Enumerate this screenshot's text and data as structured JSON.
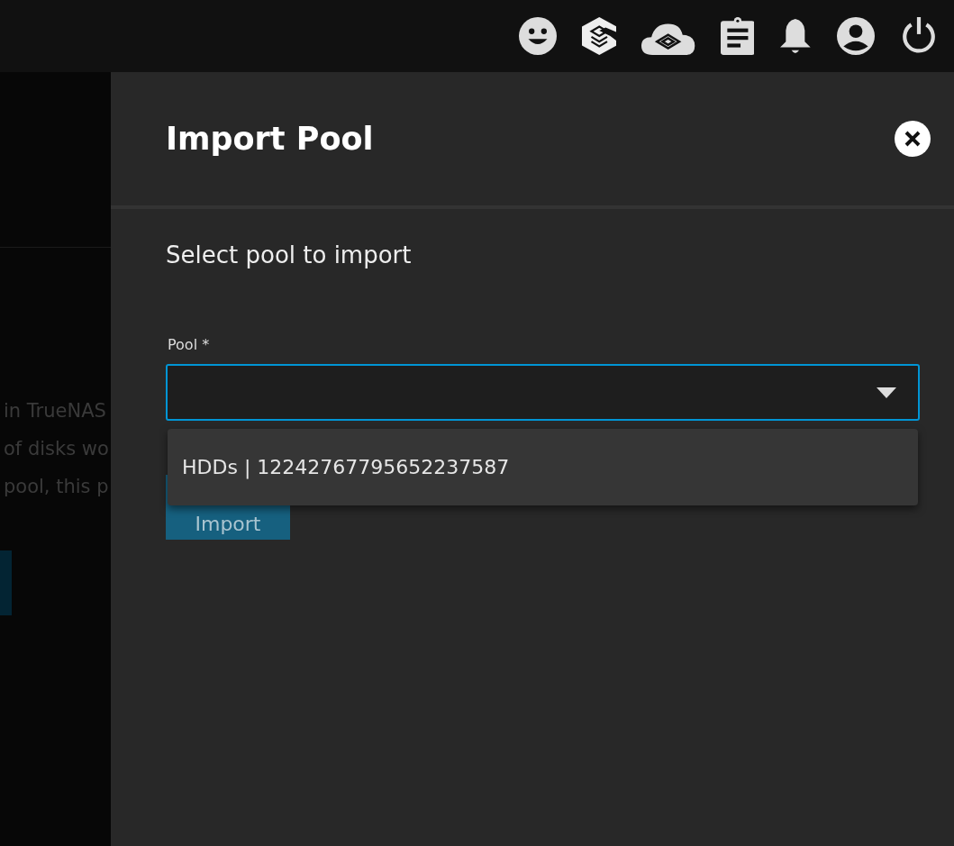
{
  "background_text": [
    "in TrueNAS",
    "of disks wo",
    "pool, this p"
  ],
  "panel": {
    "title": "Import Pool",
    "subtitle": "Select pool to import",
    "field": {
      "label": "Pool *",
      "expanded": true,
      "options": [
        "HDDs | 12242767795652237587"
      ]
    },
    "button": "Import"
  }
}
